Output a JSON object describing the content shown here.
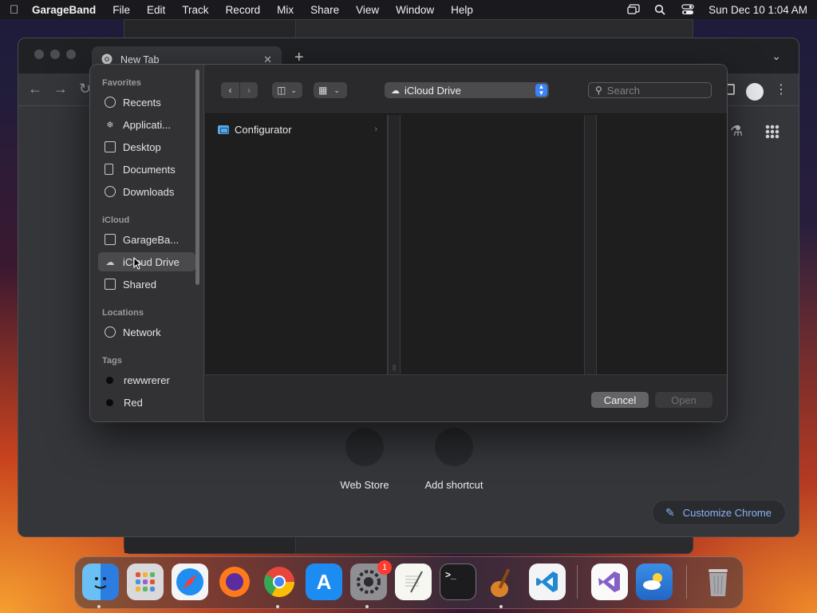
{
  "menubar": {
    "app_name": "GarageBand",
    "items": [
      "File",
      "Edit",
      "Track",
      "Record",
      "Mix",
      "Share",
      "View",
      "Window",
      "Help"
    ],
    "datetime": "Sun Dec 10  1:04 AM"
  },
  "chrome": {
    "tab_title": "New Tab",
    "shortcuts": [
      "Web Store",
      "Add shortcut"
    ],
    "customize_label": "Customize Chrome"
  },
  "dialog": {
    "sidebar": {
      "favorites_header": "Favorites",
      "favorites": [
        "Recents",
        "Applicati...",
        "Desktop",
        "Documents",
        "Downloads"
      ],
      "icloud_header": "iCloud",
      "icloud": [
        "GarageBa...",
        "iCloud Drive",
        "Shared"
      ],
      "locations_header": "Locations",
      "locations": [
        "Network"
      ],
      "tags_header": "Tags",
      "tags": [
        "rewwrerer",
        "Red"
      ]
    },
    "location_label": "iCloud Drive",
    "search_placeholder": "Search",
    "column1_items": [
      "Configurator"
    ],
    "cancel_label": "Cancel",
    "open_label": "Open"
  },
  "dock": {
    "apps": [
      "finder-icon",
      "launchpad-icon",
      "safari-icon",
      "firefox-icon",
      "chrome-icon",
      "app-store-icon",
      "system-settings-icon",
      "textedit-icon",
      "terminal-icon",
      "garageband-icon",
      "vscode-icon",
      "visual-studio-icon",
      "weather-icon",
      "trash-icon"
    ],
    "settings_badge": "1"
  },
  "colors": {
    "accent_blue": "#3b82f6",
    "chrome_link": "#8ab4f8",
    "badge_red": "#ff3b30"
  }
}
